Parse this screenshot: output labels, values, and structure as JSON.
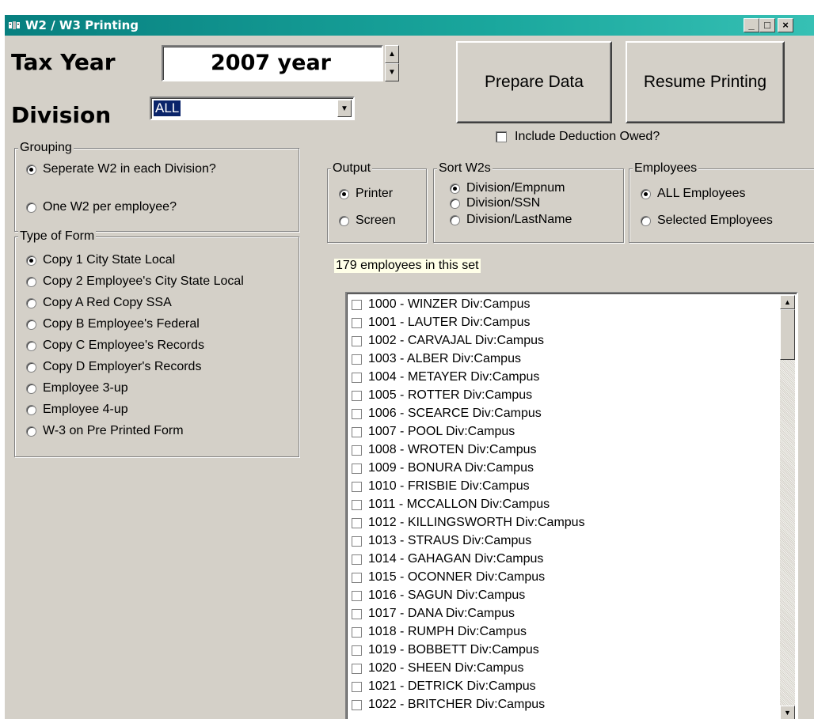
{
  "window": {
    "title": "W2 / W3 Printing",
    "minimize": "_",
    "maximize": "□",
    "close": "×"
  },
  "tax_year": {
    "label": "Tax Year",
    "value": "2007 year"
  },
  "division": {
    "label": "Division",
    "value": "ALL"
  },
  "buttons": {
    "prepare": "Prepare Data",
    "resume": "Resume Printing"
  },
  "include_deduction": {
    "label": "Include Deduction Owed?",
    "checked": false
  },
  "grouping": {
    "title": "Grouping",
    "options": [
      {
        "label": "Seperate W2 in each Division?",
        "selected": true
      },
      {
        "label": "One W2 per employee?",
        "selected": false
      }
    ]
  },
  "type_of_form": {
    "title": "Type of Form",
    "options": [
      {
        "label": "Copy 1 City State Local",
        "selected": true
      },
      {
        "label": "Copy 2 Employee's City State Local",
        "selected": false
      },
      {
        "label": "Copy A Red Copy SSA",
        "selected": false
      },
      {
        "label": "Copy B Employee's Federal",
        "selected": false
      },
      {
        "label": "Copy C Employee's Records",
        "selected": false
      },
      {
        "label": "Copy D Employer's Records",
        "selected": false
      },
      {
        "label": "Employee 3-up",
        "selected": false
      },
      {
        "label": "Employee 4-up",
        "selected": false
      },
      {
        "label": "W-3 on Pre Printed Form",
        "selected": false
      }
    ]
  },
  "output": {
    "title": "Output",
    "options": [
      {
        "label": "Printer",
        "selected": true
      },
      {
        "label": "Screen",
        "selected": false
      }
    ]
  },
  "sort": {
    "title": "Sort W2s",
    "options": [
      {
        "label": "Division/Empnum",
        "selected": true
      },
      {
        "label": "Division/SSN",
        "selected": false
      },
      {
        "label": "Division/LastName",
        "selected": false
      }
    ]
  },
  "employees_group": {
    "title": "Employees",
    "options": [
      {
        "label": "ALL Employees",
        "selected": true
      },
      {
        "label": "Selected Employees",
        "selected": false
      }
    ]
  },
  "count_label": "179 employees in this set",
  "employees": [
    "1000  -  WINZER   Div:Campus",
    "1001  -  LAUTER   Div:Campus",
    "1002  -  CARVAJAL   Div:Campus",
    "1003  -  ALBER   Div:Campus",
    "1004  -  METAYER   Div:Campus",
    "1005  -  ROTTER   Div:Campus",
    "1006  -  SCEARCE   Div:Campus",
    "1007  -  POOL   Div:Campus",
    "1008  -  WROTEN   Div:Campus",
    "1009  -  BONURA   Div:Campus",
    "1010  -  FRISBIE   Div:Campus",
    "1011  -  MCCALLON   Div:Campus",
    "1012  -  KILLINGSWORTH   Div:Campus",
    "1013  -  STRAUS   Div:Campus",
    "1014  -  GAHAGAN   Div:Campus",
    "1015  -  OCONNER   Div:Campus",
    "1016  -  SAGUN   Div:Campus",
    "1017  -  DANA   Div:Campus",
    "1018  -  RUMPH   Div:Campus",
    "1019  -  BOBBETT   Div:Campus",
    "1020  -  SHEEN   Div:Campus",
    "1021  -  DETRICK   Div:Campus",
    "1022  -  BRITCHER   Div:Campus"
  ]
}
